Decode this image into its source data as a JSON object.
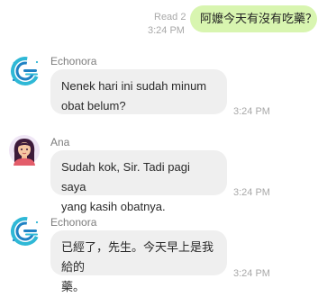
{
  "messages": [
    {
      "direction": "out",
      "status": "Read 2",
      "time": "3:24 PM",
      "text": "阿嬤今天有沒有吃藥？"
    },
    {
      "direction": "in",
      "sender": "Echonora",
      "avatar": "echonora-logo-icon",
      "text_lines": [
        "Nenek hari ini sudah minum",
        "obat belum?"
      ],
      "time": "3:24 PM"
    },
    {
      "direction": "in",
      "sender": "Ana",
      "avatar": "woman-avatar-icon",
      "text_lines": [
        "Sudah kok, Sir. Tadi pagi saya",
        "yang kasih obatnya."
      ],
      "time": "3:24 PM"
    },
    {
      "direction": "in",
      "sender": "Echonora",
      "avatar": "echonora-logo-icon",
      "text_lines": [
        "已經了，先生。今天早上是我給的",
        "藥。"
      ],
      "time": "3:24 PM"
    }
  ],
  "colors": {
    "outgoing_bubble": "#d8f5b0",
    "incoming_bubble": "#efefef",
    "meta_text": "#a8a8a8"
  }
}
